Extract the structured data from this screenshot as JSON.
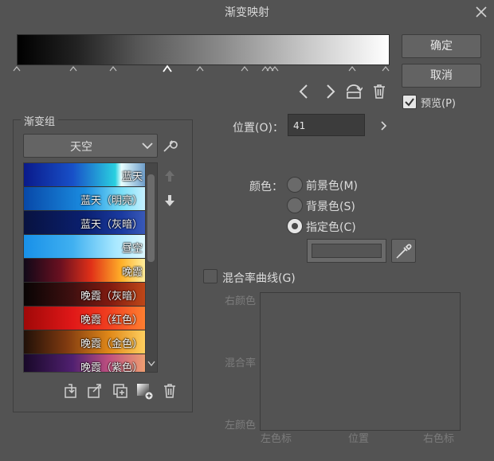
{
  "window": {
    "title": "渐变映射",
    "close_label": "✕"
  },
  "gradient": {
    "stops_left": "˄",
    "stop_selected": "˄"
  },
  "buttons": {
    "ok": "确定",
    "cancel": "取消"
  },
  "preview": {
    "label": "预览(P)",
    "checked": true
  },
  "group": {
    "legend": "渐变组",
    "selected": "天空",
    "items": [
      {
        "label": "蓝天"
      },
      {
        "label": "蓝天（明亮）"
      },
      {
        "label": "蓝天（灰暗）"
      },
      {
        "label": "昼空"
      },
      {
        "label": "晚霞"
      },
      {
        "label": "晚霞（灰暗）"
      },
      {
        "label": "晚霞（红色）"
      },
      {
        "label": "晚霞（金色）"
      },
      {
        "label": "晚霞（紫色）"
      }
    ]
  },
  "position": {
    "label": "位置(O)：",
    "value": "41"
  },
  "color": {
    "label": "颜色：",
    "options": [
      {
        "label": "前景色(M)",
        "selected": false
      },
      {
        "label": "背景色(S)",
        "selected": false
      },
      {
        "label": "指定色(C)",
        "selected": true
      }
    ]
  },
  "blend": {
    "checkbox_label": "混合率曲线(G)",
    "right_color": "右颜色",
    "blend_rate": "混合率",
    "left_color": "左颜色",
    "x_left": "左色标",
    "x_mid": "位置",
    "x_right": "右色标"
  }
}
